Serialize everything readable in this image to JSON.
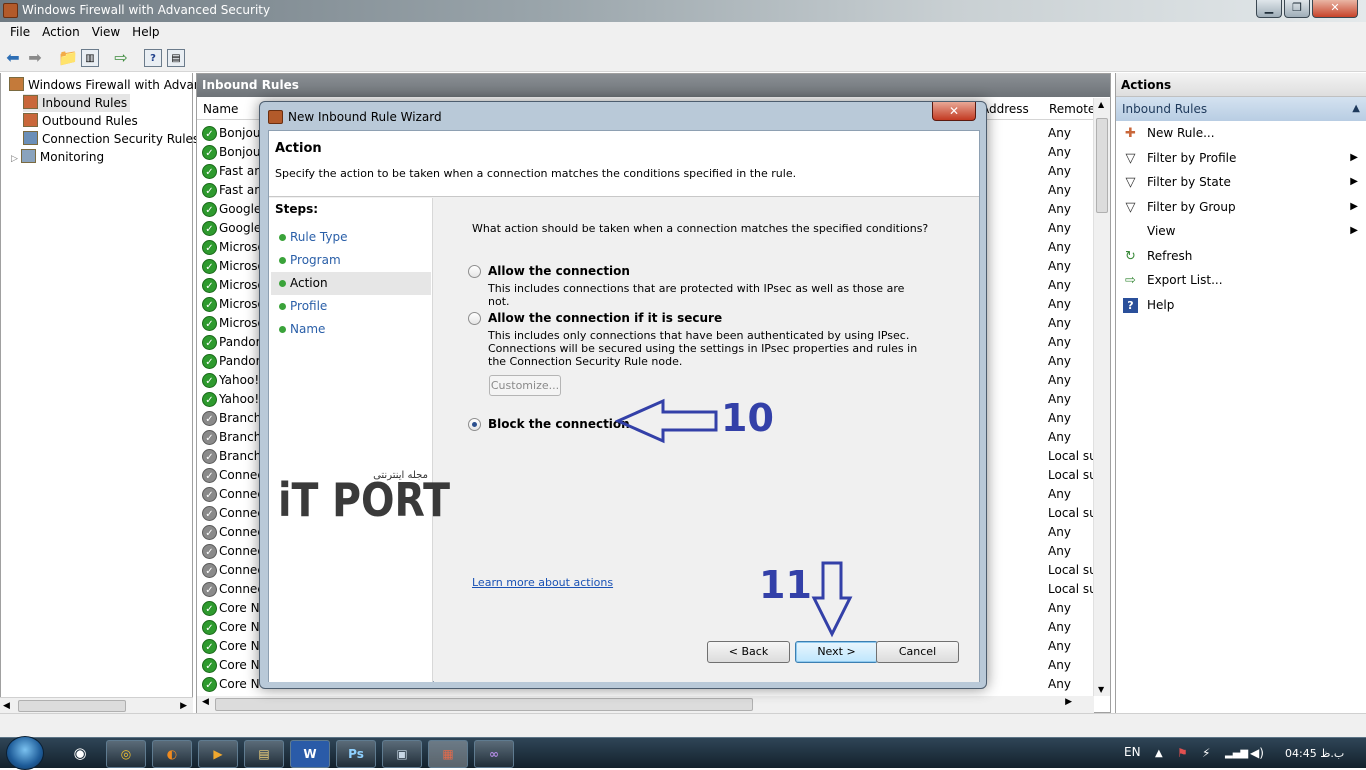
{
  "window": {
    "title": "Windows Firewall with Advanced Security"
  },
  "menu": [
    "File",
    "Action",
    "View",
    "Help"
  ],
  "tree": {
    "root": "Windows Firewall with Advance",
    "items": [
      "Inbound Rules",
      "Outbound Rules",
      "Connection Security Rules",
      "Monitoring"
    ]
  },
  "center": {
    "header": "Inbound Rules",
    "columns": {
      "name": "Name",
      "address": "Address",
      "remote": "Remote"
    },
    "rows": [
      {
        "name": "Bonjour",
        "state": "on",
        "remote": "Any"
      },
      {
        "name": "Bonjour",
        "state": "on",
        "remote": "Any"
      },
      {
        "name": "Fast and",
        "state": "on",
        "remote": "Any"
      },
      {
        "name": "Fast and",
        "state": "on",
        "remote": "Any"
      },
      {
        "name": "Google",
        "state": "on",
        "remote": "Any"
      },
      {
        "name": "Google",
        "state": "on",
        "remote": "Any"
      },
      {
        "name": "Microso",
        "state": "on",
        "remote": "Any"
      },
      {
        "name": "Microso",
        "state": "on",
        "remote": "Any"
      },
      {
        "name": "Microso",
        "state": "on",
        "remote": "Any"
      },
      {
        "name": "Microso",
        "state": "on",
        "remote": "Any"
      },
      {
        "name": "Microso",
        "state": "on",
        "remote": "Any"
      },
      {
        "name": "Pandora",
        "state": "on",
        "remote": "Any"
      },
      {
        "name": "Pandora",
        "state": "on",
        "remote": "Any"
      },
      {
        "name": "Yahoo!",
        "state": "on",
        "remote": "Any"
      },
      {
        "name": "Yahoo!",
        "state": "on",
        "remote": "Any"
      },
      {
        "name": "BranchC",
        "state": "off",
        "remote": "Any"
      },
      {
        "name": "BranchC",
        "state": "off",
        "remote": "Any"
      },
      {
        "name": "BranchC",
        "state": "off",
        "remote": "Local su"
      },
      {
        "name": "Connec",
        "state": "off",
        "remote": "Local su"
      },
      {
        "name": "Connec",
        "state": "off",
        "remote": "Any"
      },
      {
        "name": "Connec",
        "state": "off",
        "remote": "Local su"
      },
      {
        "name": "Connec",
        "state": "off",
        "remote": "Any"
      },
      {
        "name": "Connec",
        "state": "off",
        "remote": "Any"
      },
      {
        "name": "Connec",
        "state": "off",
        "remote": "Local su"
      },
      {
        "name": "Connec",
        "state": "off",
        "remote": "Local su"
      },
      {
        "name": "Core Ne",
        "state": "on",
        "remote": "Any"
      },
      {
        "name": "Core Ne",
        "state": "on",
        "remote": "Any"
      },
      {
        "name": "Core Ne",
        "state": "on",
        "remote": "Any"
      },
      {
        "name": "Core Ne",
        "state": "on",
        "remote": "Any"
      },
      {
        "name": "Core Ne",
        "state": "on",
        "remote": "Any"
      }
    ]
  },
  "actions": {
    "header": "Actions",
    "section": "Inbound Rules",
    "items": [
      {
        "label": "New Rule...",
        "icon": "new-rule-icon",
        "submenu": false
      },
      {
        "label": "Filter by Profile",
        "icon": "filter-icon",
        "submenu": true
      },
      {
        "label": "Filter by State",
        "icon": "filter-icon",
        "submenu": true
      },
      {
        "label": "Filter by Group",
        "icon": "filter-icon",
        "submenu": true
      },
      {
        "label": "View",
        "icon": "",
        "submenu": true
      },
      {
        "label": "Refresh",
        "icon": "refresh-icon",
        "submenu": false
      },
      {
        "label": "Export List...",
        "icon": "export-icon",
        "submenu": false
      },
      {
        "label": "Help",
        "icon": "help-icon",
        "submenu": false
      }
    ]
  },
  "dialog": {
    "title": "New Inbound Rule Wizard",
    "heading": "Action",
    "description": "Specify the action to be taken when a connection matches the conditions specified in the rule.",
    "steps_label": "Steps:",
    "steps": [
      "Rule Type",
      "Program",
      "Action",
      "Profile",
      "Name"
    ],
    "current_step": "Action",
    "question": "What action should be taken when a connection matches the specified conditions?",
    "options": [
      {
        "label": "Allow the connection",
        "desc": "This includes connections that are protected with IPsec as well as those are not.",
        "selected": false
      },
      {
        "label": "Allow the connection if it is secure",
        "desc": "This includes only connections that have been authenticated by using IPsec.  Connections will be secured using the settings in IPsec properties and rules in the Connection Security Rule node.",
        "selected": false
      },
      {
        "label": "Block the connection",
        "desc": "",
        "selected": true
      }
    ],
    "customize_label": "Customize...",
    "learn_more": "Learn more about actions",
    "back_label": "< Back",
    "next_label": "Next >",
    "cancel_label": "Cancel"
  },
  "annotations": {
    "step10": "10",
    "step11": "11"
  },
  "watermark": {
    "text": "iT PORT",
    "tagline": "مجله اینترنتی"
  },
  "taskbar": {
    "lang": "EN",
    "time": "04:45 ب.ظ"
  },
  "colors": {
    "accent_arrow": "#3340a8",
    "enabled_rule": "#2e9a2e",
    "disabled_rule": "#8a8a8a",
    "link": "#1a52b5"
  }
}
